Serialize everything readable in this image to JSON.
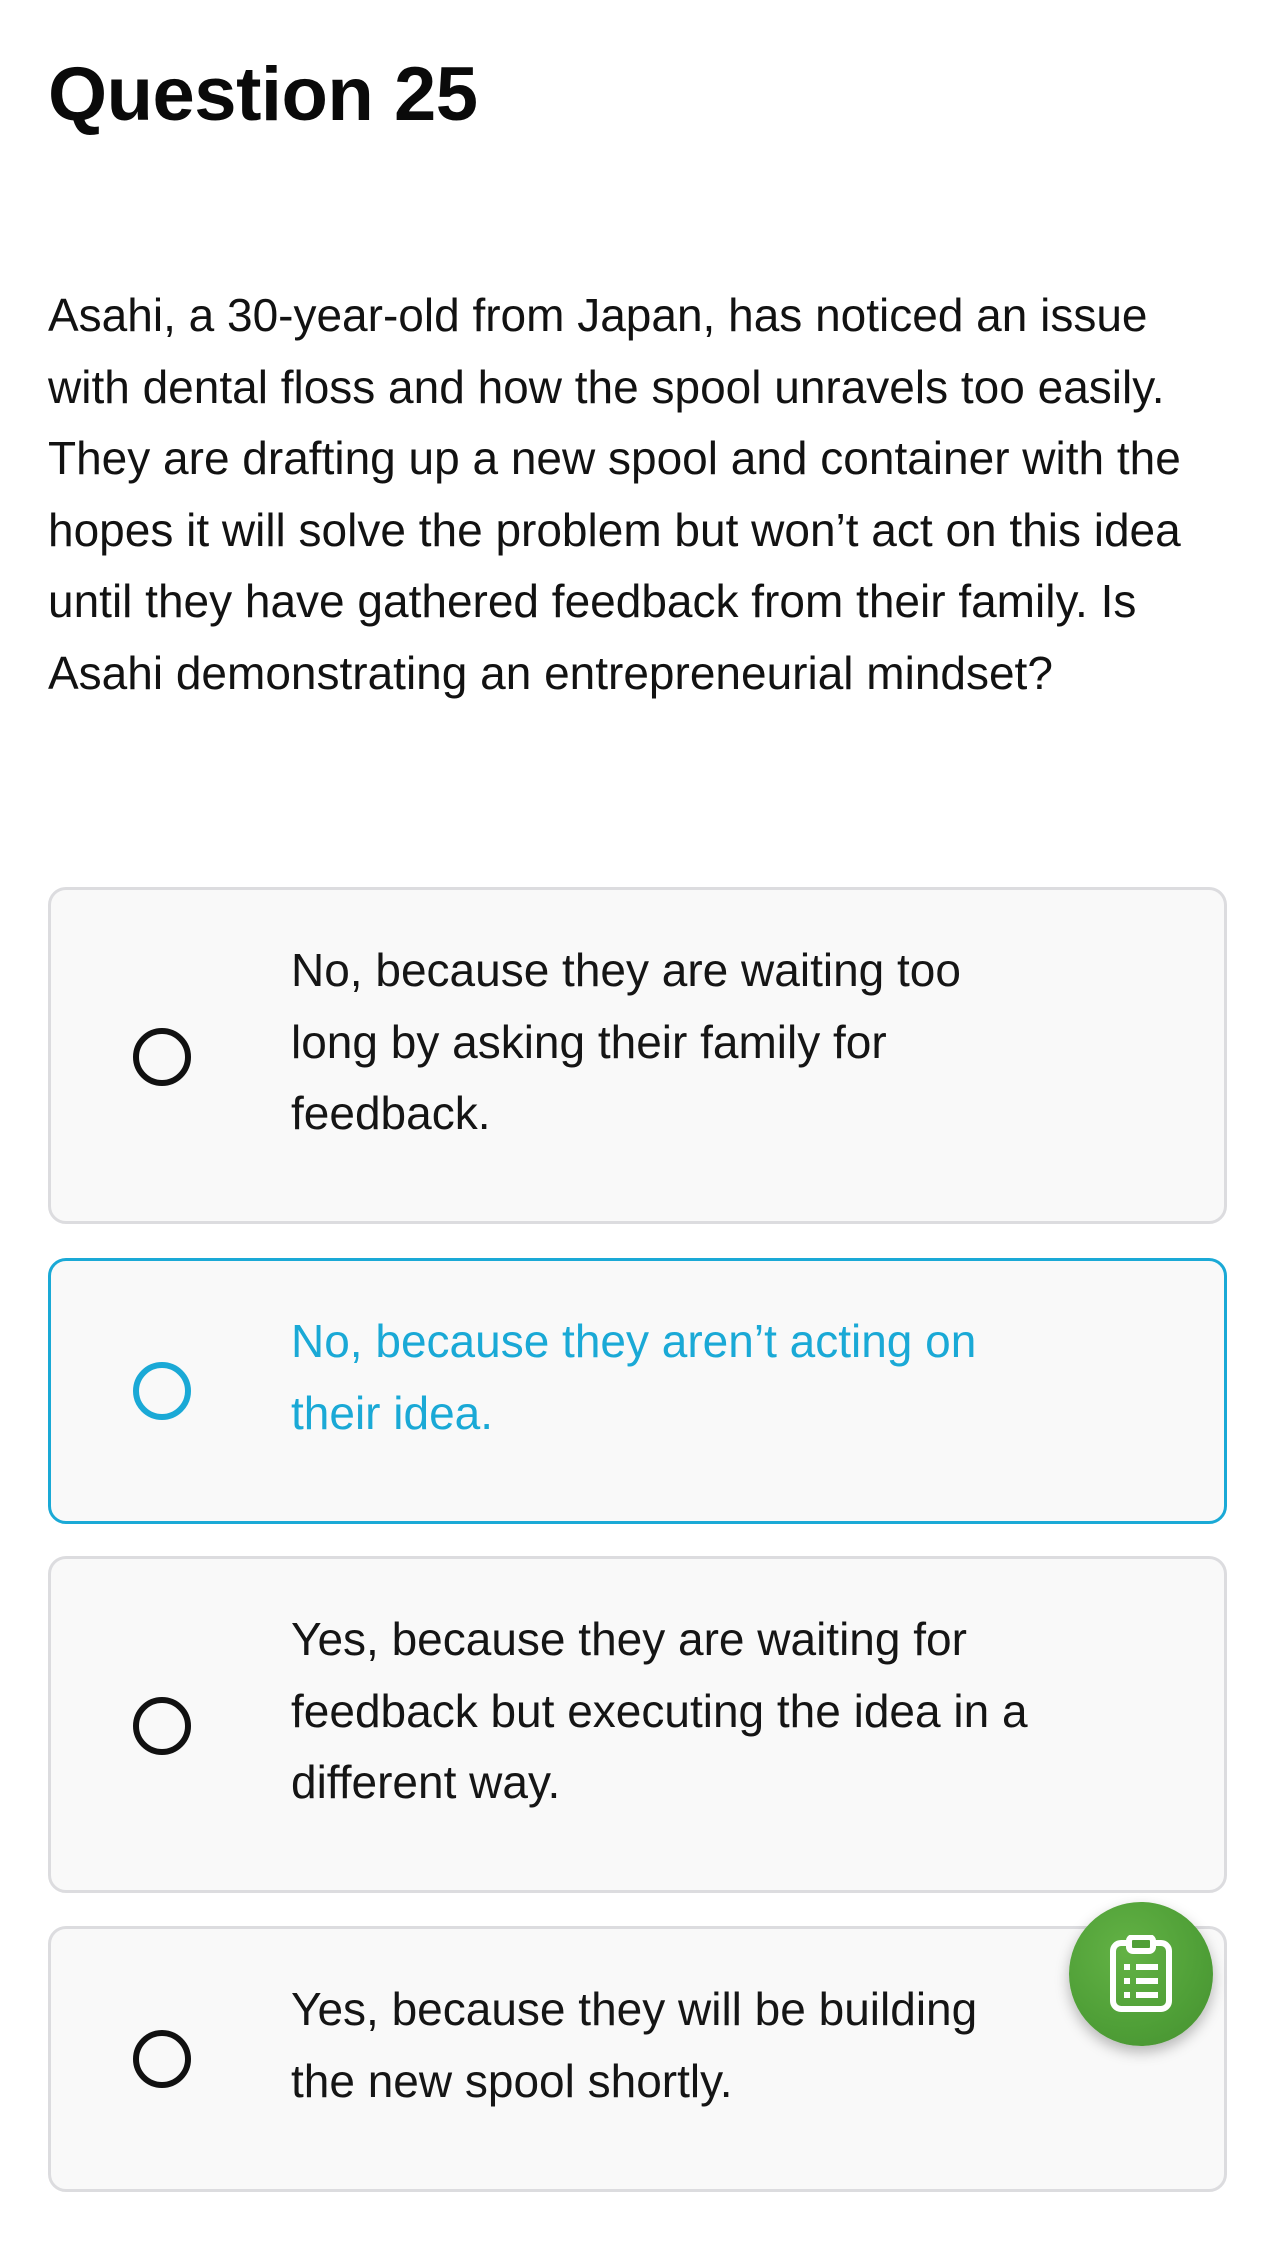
{
  "question": {
    "title": "Question 25",
    "text": "Asahi, a 30-year-old from Japan, has noticed an issue with dental floss and how the spool unravels too easily. They are drafting up a new spool and container with the hopes it will solve the problem but won’t act on this idea until they have gathered feedback from their family. Is Asahi demonstrating an entrepreneurial mindset?"
  },
  "options": [
    {
      "label": "No, because they are waiting too long by asking their family for feedback.",
      "selected": false
    },
    {
      "label": "No, because they aren’t acting on their idea.",
      "selected": true
    },
    {
      "label": "Yes, because they are waiting for feedback but executing the idea in a different way.",
      "selected": false
    },
    {
      "label": "Yes, because they will be building the new spool shortly.",
      "selected": false
    }
  ],
  "fab": {
    "icon": "clipboard-list-icon"
  },
  "colors": {
    "accent": "#1aa9d6",
    "fab_green": "#4f9f37",
    "card_background": "#f9f9f9",
    "card_border": "#dcdcdf"
  }
}
